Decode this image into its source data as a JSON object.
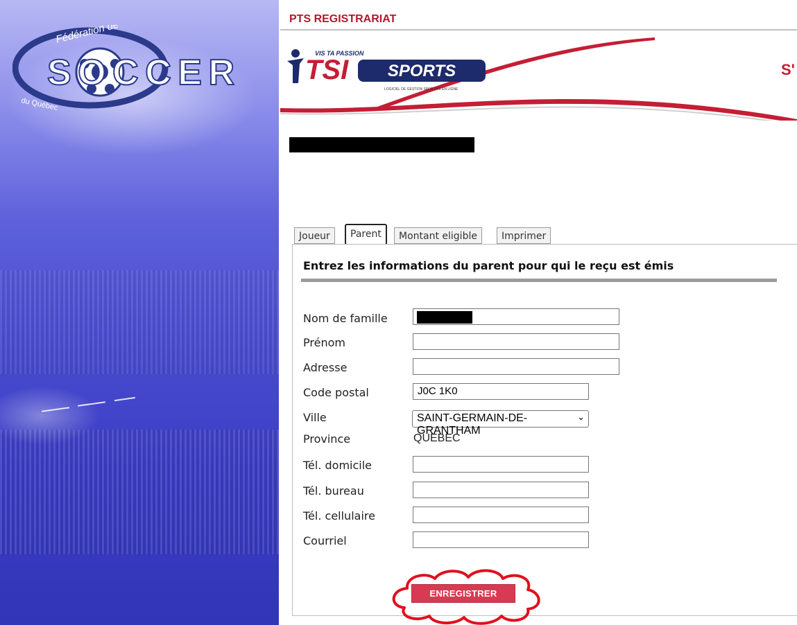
{
  "left_banner": {
    "logo_top_text": "Fédération de",
    "logo_main_text": "SOCCER",
    "logo_bottom_text": "du Québec"
  },
  "topbar": {
    "title": "PTS REGISTRARIAT"
  },
  "header": {
    "tagline": "VIS TA PASSION",
    "brand_tsi": "TSI",
    "brand_sports": "SPORTS",
    "brand_sub": "LOGICIEL DE GESTION SPORTIVE EN LIGNE",
    "right_text": "S'"
  },
  "tabs": [
    {
      "label": "Joueur"
    },
    {
      "label": "Parent"
    },
    {
      "label": "Montant eligible"
    },
    {
      "label": "Imprimer"
    }
  ],
  "form": {
    "heading": "Entrez les informations du parent pour qui le reçu est émis",
    "fields": {
      "nom": {
        "label": "Nom de famille",
        "value": ""
      },
      "prenom": {
        "label": "Prénom",
        "value": ""
      },
      "adresse": {
        "label": "Adresse",
        "value": ""
      },
      "code_postal": {
        "label": "Code postal",
        "value": "J0C 1K0"
      },
      "ville": {
        "label": "Ville",
        "value": "SAINT-GERMAIN-DE-GRANTHAM"
      },
      "province": {
        "label": "Province",
        "value": "QUEBEC"
      },
      "tel_domicile": {
        "label": "Tél. domicile",
        "value": ""
      },
      "tel_bureau": {
        "label": "Tél. bureau",
        "value": ""
      },
      "tel_cellulaire": {
        "label": "Tél. cellulaire",
        "value": ""
      },
      "courriel": {
        "label": "Courriel",
        "value": ""
      }
    },
    "save_label": "ENREGISTRER"
  },
  "colors": {
    "brand_red": "#b3182b",
    "button_red": "#d93a53",
    "annotation_red": "#e0101e"
  }
}
